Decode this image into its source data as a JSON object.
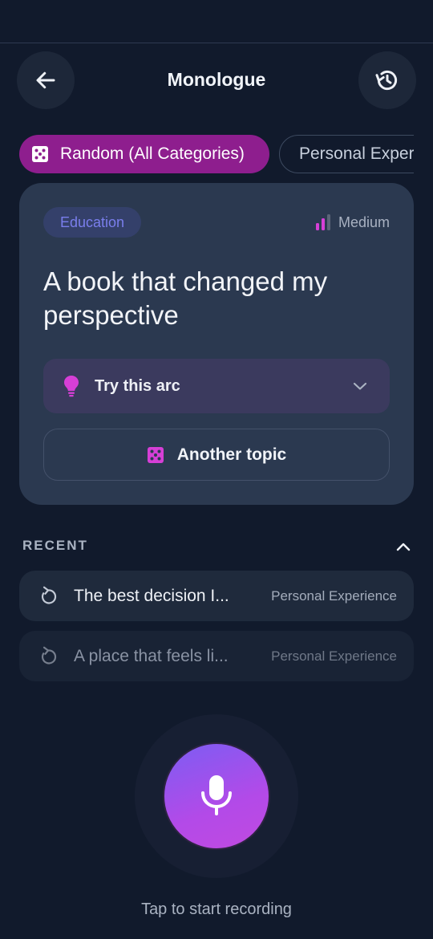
{
  "header": {
    "title": "Monologue",
    "back_icon": "arrow-left-icon",
    "history_icon": "history-icon"
  },
  "categories": {
    "active": {
      "label": "Random (All Categories)",
      "icon": "dice-icon"
    },
    "next": {
      "label": "Personal Exper"
    }
  },
  "card": {
    "tag": "Education",
    "difficulty": "Medium",
    "difficulty_icon": "signal-bars-icon",
    "topic": "A book that changed my perspective",
    "arc_label": "Try this arc",
    "arc_icon": "lightbulb-icon",
    "another_label": "Another topic"
  },
  "recent": {
    "title": "RECENT",
    "items": [
      {
        "text": "The best decision I...",
        "category": "Personal Experience"
      },
      {
        "text": "A place that feels li...",
        "category": "Personal Experience"
      }
    ]
  },
  "record": {
    "hint": "Tap to start recording",
    "icon": "microphone-icon"
  },
  "colors": {
    "background": "#111a2c",
    "accent_magenta": "#8e1e8e",
    "icon_magenta": "#d63fd6",
    "tag_text": "#7a7eec",
    "mic_gradient_start": "#7c5df3",
    "mic_gradient_end": "#c04ae0"
  }
}
